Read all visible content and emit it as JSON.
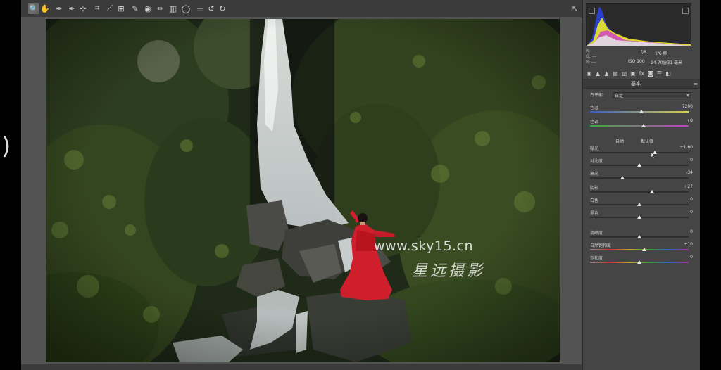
{
  "toolbar": {
    "tools": [
      {
        "name": "zoom-tool",
        "icon": "magnifier-icon",
        "glyph": "🔍"
      },
      {
        "name": "hand-tool",
        "icon": "hand-icon",
        "glyph": "✋"
      },
      {
        "name": "white-balance-tool",
        "icon": "eyedropper-icon",
        "glyph": "✒"
      },
      {
        "name": "color-sampler-tool",
        "icon": "color-sampler-icon",
        "glyph": "✒"
      },
      {
        "name": "targeted-adjustment-tool",
        "icon": "target-adjust-icon",
        "glyph": "⊹"
      },
      {
        "name": "crop-tool",
        "icon": "crop-icon",
        "glyph": "⌗"
      },
      {
        "name": "straighten-tool",
        "icon": "straighten-icon",
        "glyph": "⟋"
      },
      {
        "name": "transform-tool",
        "icon": "transform-icon",
        "glyph": "⊞"
      },
      {
        "name": "spot-removal-tool",
        "icon": "spot-removal-icon",
        "glyph": "✎"
      },
      {
        "name": "red-eye-tool",
        "icon": "red-eye-icon",
        "glyph": "◉"
      },
      {
        "name": "adjustment-brush-tool",
        "icon": "brush-icon",
        "glyph": "✏"
      },
      {
        "name": "graduated-filter-tool",
        "icon": "graduated-filter-icon",
        "glyph": "▥"
      },
      {
        "name": "radial-filter-tool",
        "icon": "radial-filter-icon",
        "glyph": "◯"
      },
      {
        "name": "preferences-tool",
        "icon": "preferences-icon",
        "glyph": "☰"
      },
      {
        "name": "rotate-left-tool",
        "icon": "rotate-left-icon",
        "glyph": "↺"
      },
      {
        "name": "rotate-right-tool",
        "icon": "rotate-right-icon",
        "glyph": "↻"
      }
    ],
    "fullscreen_icon": "fullscreen-icon"
  },
  "edge": {
    "left_glyph": ")"
  },
  "watermark": {
    "url": "www.sky15.cn",
    "signature": "星远摄影"
  },
  "camera": {
    "r_label": "R:",
    "g_label": "G:",
    "b_label": "B:",
    "r_value": "---",
    "g_value": "---",
    "b_value": "---",
    "aperture": "f/8",
    "shutter": "1/6 秒",
    "iso": "ISO 100",
    "lens": "24-70@31 毫米"
  },
  "panel": {
    "section_title": "基本",
    "white_balance_label": "白平衡:",
    "white_balance_value": "自定",
    "auto_label": "自动",
    "default_label": "默认值"
  },
  "sliders": [
    {
      "key": "temperature",
      "label": "色温",
      "value": "7200",
      "level": 0.52,
      "gradient": "linear-gradient(90deg,#3b5cc4,#d8d04a)"
    },
    {
      "key": "tint",
      "label": "色调",
      "value": "+8",
      "level": 0.54,
      "gradient": "linear-gradient(90deg,#3fae3f,#c23fc2)"
    },
    {
      "key": "exposure",
      "label": "曝光",
      "value": "+1.60",
      "level": 0.66,
      "gradient": ""
    },
    {
      "key": "contrast",
      "label": "对比度",
      "value": "0",
      "level": 0.5,
      "gradient": ""
    },
    {
      "key": "highlights",
      "label": "高光",
      "value": "-34",
      "level": 0.33,
      "gradient": ""
    },
    {
      "key": "shadows",
      "label": "阴影",
      "value": "+27",
      "level": 0.63,
      "gradient": ""
    },
    {
      "key": "whites",
      "label": "白色",
      "value": "0",
      "level": 0.5,
      "gradient": ""
    },
    {
      "key": "blacks",
      "label": "黑色",
      "value": "0",
      "level": 0.5,
      "gradient": ""
    },
    {
      "key": "clarity",
      "label": "清晰度",
      "value": "0",
      "level": 0.5,
      "gradient": ""
    },
    {
      "key": "vibrance",
      "label": "自然饱和度",
      "value": "+10",
      "level": 0.55,
      "gradient": "linear-gradient(90deg,#8a8a8a,#c23030,#c2a030,#30a030,#3060c2,#a030a0)"
    },
    {
      "key": "saturation",
      "label": "饱和度",
      "value": "0",
      "level": 0.5,
      "gradient": "linear-gradient(90deg,#8a8a8a,#c23030,#c2a030,#30a030,#3060c2,#a030a0)"
    }
  ],
  "colors": {
    "app_bg": "#535353",
    "panel_bg": "#454545",
    "toolbar_bg": "#3b3b3b",
    "dress": "#d01f2c"
  }
}
